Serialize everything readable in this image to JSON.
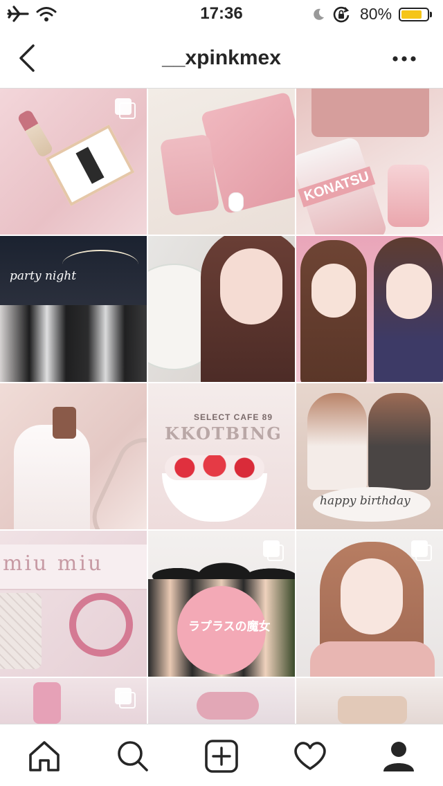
{
  "status_bar": {
    "time": "17:36",
    "battery_percent": "80%",
    "battery_level": 0.8,
    "battery_color": "#f5c518",
    "icons": [
      "airplane-mode-icon",
      "wifi-icon",
      "moon-icon",
      "orientation-lock-icon",
      "battery-icon"
    ]
  },
  "header": {
    "username": "__xpinkmex",
    "back_icon": "chevron-left-icon",
    "more_icon": "more-dots-icon"
  },
  "grid": {
    "rows_visible": 5,
    "posts": [
      {
        "name": "post-lipstick-card",
        "multi": true
      },
      {
        "name": "post-laptop-cardholder",
        "multi": false
      },
      {
        "name": "post-backpack-phonecase",
        "multi": false,
        "text": "KONATSU"
      },
      {
        "name": "post-party-night",
        "multi": false,
        "text": "party night"
      },
      {
        "name": "post-selfie-1",
        "multi": false
      },
      {
        "name": "post-two-girls",
        "multi": false
      },
      {
        "name": "post-mirror-selfie",
        "multi": false
      },
      {
        "name": "post-strawberry-dessert",
        "multi": false,
        "text": "SELECT CAFE 89",
        "text2": "KKOTBING"
      },
      {
        "name": "post-birthday-cafe",
        "multi": false,
        "text": "happy birthday"
      },
      {
        "name": "post-miumiu-bracelet",
        "multi": false,
        "text": "miu miu"
      },
      {
        "name": "post-halloween-witches",
        "multi": true,
        "text": "ラプラスの魔女"
      },
      {
        "name": "post-selfie-2",
        "multi": true
      },
      {
        "name": "post-partial-1",
        "multi": true
      },
      {
        "name": "post-partial-2",
        "multi": false
      },
      {
        "name": "post-partial-3",
        "multi": false
      }
    ]
  },
  "tab_bar": {
    "tabs": [
      {
        "name": "tab-home",
        "icon": "home-icon",
        "active": false
      },
      {
        "name": "tab-search",
        "icon": "search-icon",
        "active": false
      },
      {
        "name": "tab-new-post",
        "icon": "add-post-icon",
        "active": false
      },
      {
        "name": "tab-activity",
        "icon": "heart-icon",
        "active": false
      },
      {
        "name": "tab-profile",
        "icon": "profile-icon",
        "active": true
      }
    ]
  }
}
